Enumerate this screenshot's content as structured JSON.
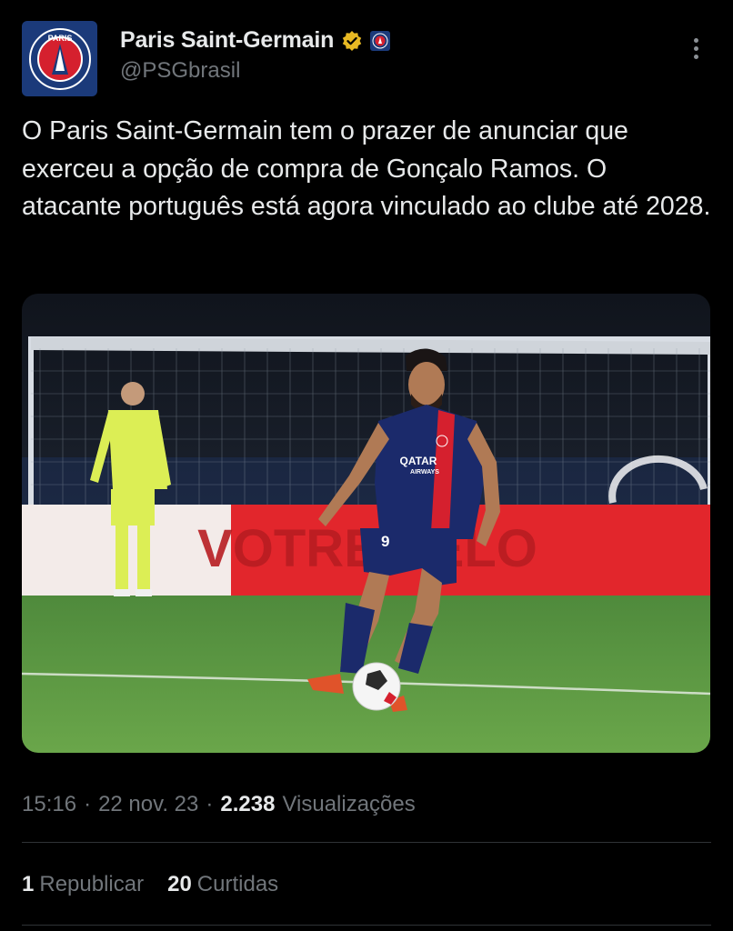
{
  "account": {
    "display_name": "Paris Saint-Germain",
    "handle": "@PSGbrasil",
    "avatar_label": "PARIS"
  },
  "tweet": {
    "text": "O Paris Saint-Germain tem o prazer de anunciar que exerceu a opção de compra de Gonçalo Ramos. O atacante português está agora vinculado ao clube até 2028."
  },
  "media": {
    "description_icon": "photo-football-player",
    "ad_board_text": "VOTRE VÉLO",
    "jersey_sponsor": "QATAR",
    "jersey_sponsor_sub": "AIRWAYS",
    "jersey_number": "9"
  },
  "meta": {
    "time": "15:16",
    "date": "22 nov. 23",
    "views_count": "2.238",
    "views_label": "Visualizações"
  },
  "stats": {
    "reposts_count": "1",
    "reposts_label": "Republicar",
    "likes_count": "20",
    "likes_label": "Curtidas"
  },
  "colors": {
    "background": "#000000",
    "text_primary": "#e7e9ea",
    "text_secondary": "#71767b",
    "verified_badge": "#e8b923",
    "psg_navy": "#1b3a7a",
    "psg_red": "#d5202e"
  }
}
